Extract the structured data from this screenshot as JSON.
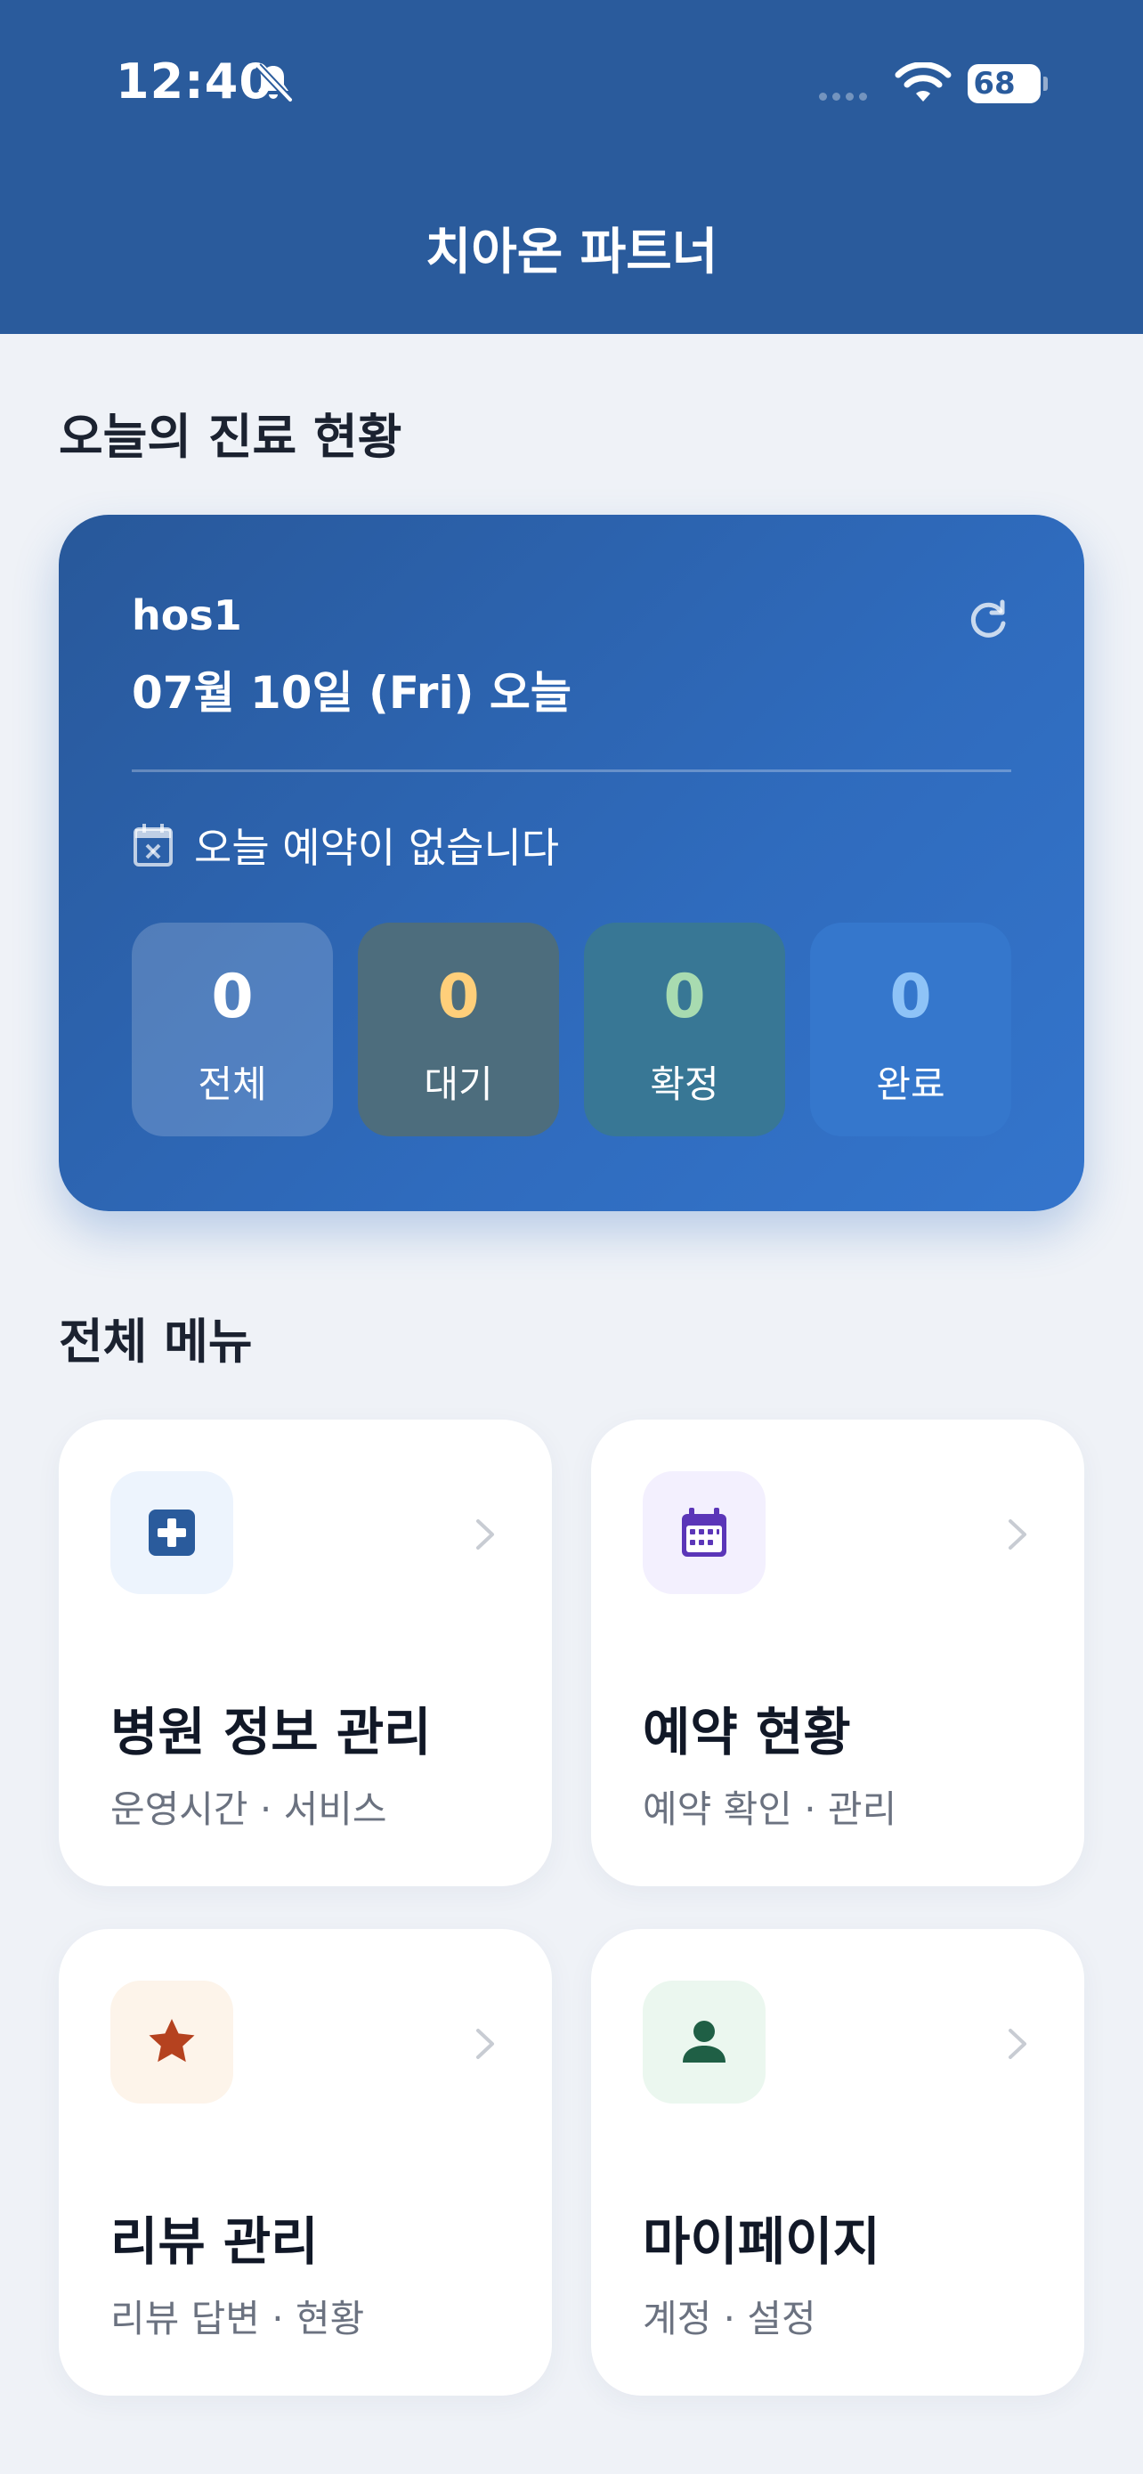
{
  "status_bar": {
    "time": "12:40",
    "battery": "68"
  },
  "header": {
    "title": "치아온 파트너"
  },
  "today": {
    "section_title": "오늘의 진료 현황",
    "hospital": "hos1",
    "date": "07월 10일 (Fri) 오늘",
    "empty_message": "오늘 예약이 없습니다",
    "stats": [
      {
        "value": "0",
        "label": "전체",
        "color": "#ffffff"
      },
      {
        "value": "0",
        "label": "대기",
        "color": "#ffcf7a"
      },
      {
        "value": "0",
        "label": "확정",
        "color": "#a8dbb0"
      },
      {
        "value": "0",
        "label": "완료",
        "color": "#8ec3f7"
      }
    ]
  },
  "menu": {
    "section_title": "전체 메뉴",
    "items": [
      {
        "title": "병원 정보 관리",
        "subtitle": "운영시간 · 서비스",
        "icon": "hospital-plus-icon"
      },
      {
        "title": "예약 현황",
        "subtitle": "예약 확인 · 관리",
        "icon": "calendar-icon"
      },
      {
        "title": "리뷰 관리",
        "subtitle": "리뷰 답변 · 현황",
        "icon": "star-icon"
      },
      {
        "title": "마이페이지",
        "subtitle": "계정 · 설정",
        "icon": "person-icon"
      }
    ]
  },
  "colors": {
    "header": "#2a5b9c",
    "card_gradient_start": "#28589a",
    "card_gradient_end": "#3475cc",
    "background": "#eff2f7"
  }
}
